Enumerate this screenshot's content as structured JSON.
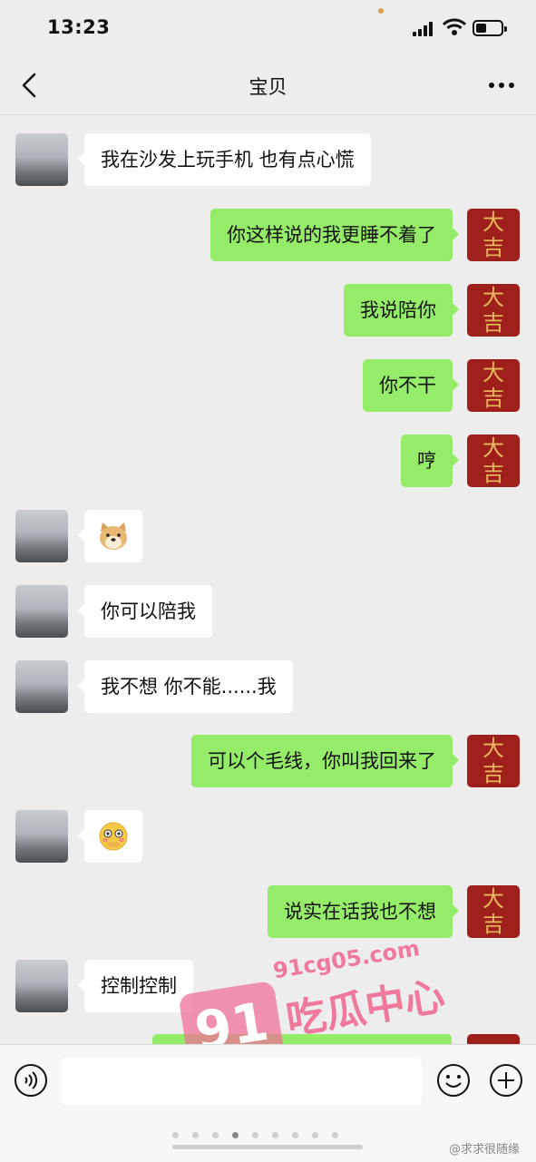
{
  "status_bar": {
    "time": "13:23"
  },
  "header": {
    "title": "宝贝"
  },
  "messages": [
    {
      "side": "left",
      "type": "text",
      "text": "我在沙发上玩手机 也有点心慌"
    },
    {
      "side": "right",
      "type": "text",
      "text": "你这样说的我更睡不着了"
    },
    {
      "side": "right",
      "type": "text",
      "text": "我说陪你"
    },
    {
      "side": "right",
      "type": "text",
      "text": "你不干"
    },
    {
      "side": "right",
      "type": "text",
      "text": "哼"
    },
    {
      "side": "left",
      "type": "emoji",
      "icon": "doge-emoji"
    },
    {
      "side": "left",
      "type": "text",
      "text": "你可以陪我"
    },
    {
      "side": "left",
      "type": "text",
      "text": "我不想 你不能......我"
    },
    {
      "side": "right",
      "type": "text",
      "text": "可以个毛线，你叫我回来了"
    },
    {
      "side": "left",
      "type": "emoji",
      "icon": "shy-emoji"
    },
    {
      "side": "right",
      "type": "text",
      "text": "说实在话我也不想"
    },
    {
      "side": "left",
      "type": "text",
      "text": "控制控制"
    }
  ],
  "my_avatar": {
    "line1": "大",
    "line2": "吉"
  },
  "input": {
    "value": ""
  },
  "watermark": {
    "number": "91",
    "url": "91cg05.com",
    "name": "吃瓜中心"
  },
  "credit": "@求求很随缘"
}
